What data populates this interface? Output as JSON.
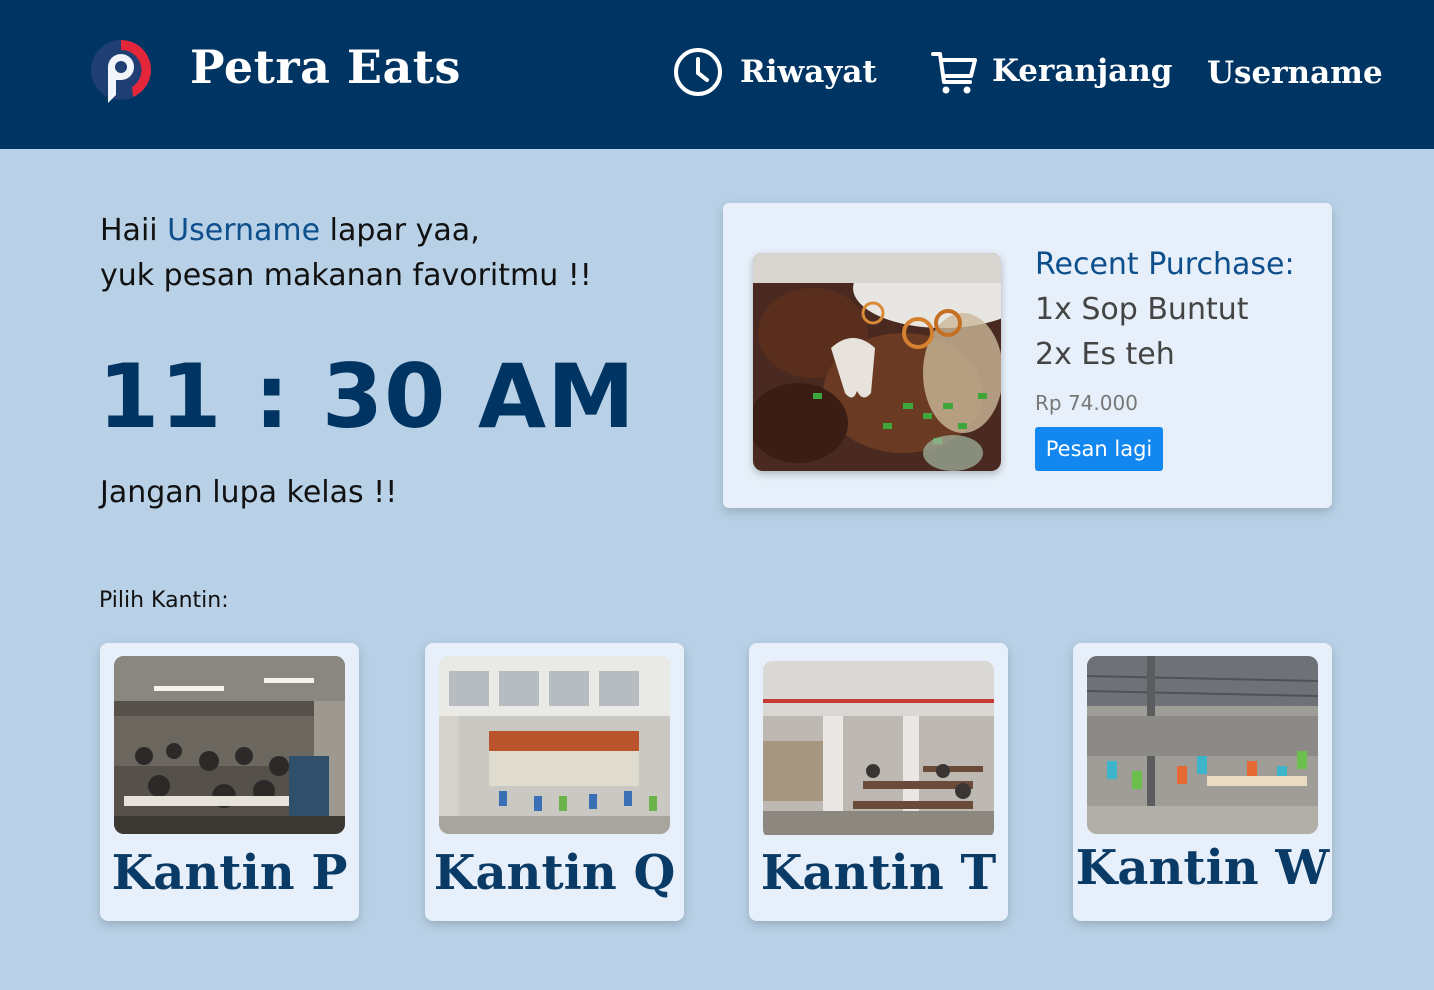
{
  "header": {
    "brand": "Petra Eats",
    "nav": {
      "history": "Riwayat",
      "cart": "Keranjang",
      "user": "Username"
    }
  },
  "greeting": {
    "prefix": "Haii",
    "username": "Username",
    "suffix": "lapar yaa,",
    "line2": "yuk pesan makanan favoritmu !!"
  },
  "clock": "11 : 30 AM",
  "reminder": "Jangan lupa kelas !!",
  "recent_purchase": {
    "title": "Recent Purchase:",
    "items": [
      "1x Sop Buntut",
      "2x Es teh"
    ],
    "price": "Rp 74.000",
    "button": "Pesan lagi"
  },
  "canteen_section": {
    "label": "Pilih Kantin:",
    "canteens": [
      {
        "name": "Kantin P"
      },
      {
        "name": "Kantin Q"
      },
      {
        "name": "Kantin T"
      },
      {
        "name": "Kantin W"
      }
    ]
  },
  "colors": {
    "header_bg": "#003462",
    "page_bg": "#b9d1e7",
    "card_bg": "#e7f0fa",
    "accent": "#1287f0",
    "clock": "#003462"
  },
  "icons": {
    "history": "clock-icon",
    "cart": "cart-icon",
    "logo": "petra-logo-icon"
  }
}
